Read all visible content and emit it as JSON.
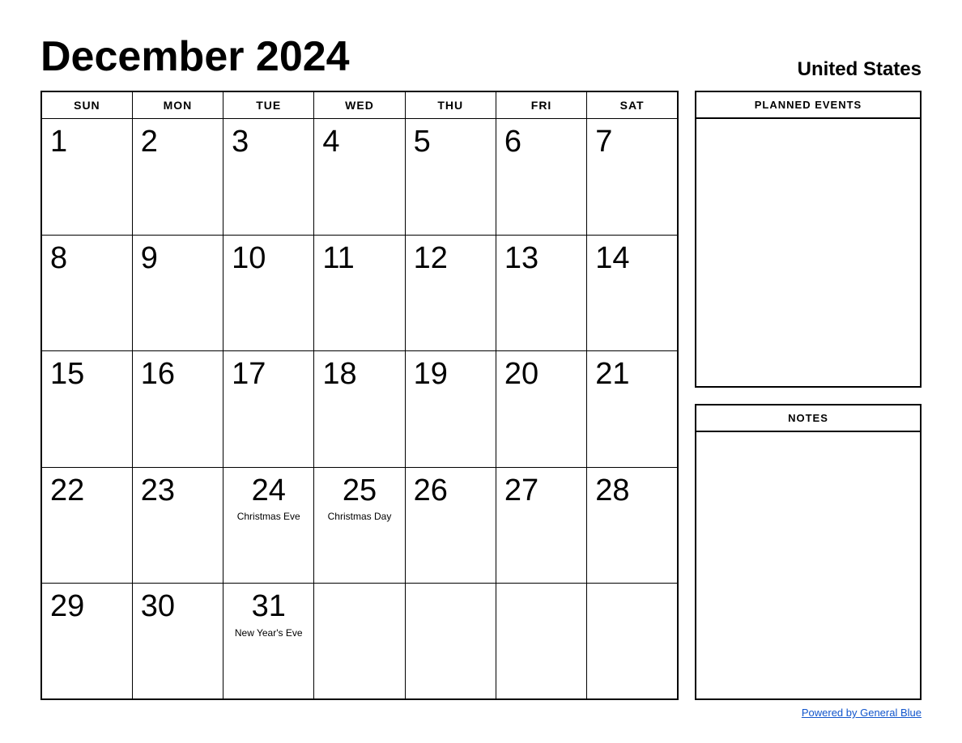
{
  "header": {
    "title": "December 2024",
    "country": "United States"
  },
  "calendar": {
    "days_of_week": [
      "SUN",
      "MON",
      "TUE",
      "WED",
      "THU",
      "FRI",
      "SAT"
    ],
    "weeks": [
      [
        {
          "day": "1",
          "holiday": ""
        },
        {
          "day": "2",
          "holiday": ""
        },
        {
          "day": "3",
          "holiday": ""
        },
        {
          "day": "4",
          "holiday": ""
        },
        {
          "day": "5",
          "holiday": ""
        },
        {
          "day": "6",
          "holiday": ""
        },
        {
          "day": "7",
          "holiday": ""
        }
      ],
      [
        {
          "day": "8",
          "holiday": ""
        },
        {
          "day": "9",
          "holiday": ""
        },
        {
          "day": "10",
          "holiday": ""
        },
        {
          "day": "11",
          "holiday": ""
        },
        {
          "day": "12",
          "holiday": ""
        },
        {
          "day": "13",
          "holiday": ""
        },
        {
          "day": "14",
          "holiday": ""
        }
      ],
      [
        {
          "day": "15",
          "holiday": ""
        },
        {
          "day": "16",
          "holiday": ""
        },
        {
          "day": "17",
          "holiday": ""
        },
        {
          "day": "18",
          "holiday": ""
        },
        {
          "day": "19",
          "holiday": ""
        },
        {
          "day": "20",
          "holiday": ""
        },
        {
          "day": "21",
          "holiday": ""
        }
      ],
      [
        {
          "day": "22",
          "holiday": ""
        },
        {
          "day": "23",
          "holiday": ""
        },
        {
          "day": "24",
          "holiday": "Christmas Eve"
        },
        {
          "day": "25",
          "holiday": "Christmas Day"
        },
        {
          "day": "26",
          "holiday": ""
        },
        {
          "day": "27",
          "holiday": ""
        },
        {
          "day": "28",
          "holiday": ""
        }
      ],
      [
        {
          "day": "29",
          "holiday": ""
        },
        {
          "day": "30",
          "holiday": ""
        },
        {
          "day": "31",
          "holiday": "New Year's Eve"
        },
        {
          "day": "",
          "holiday": ""
        },
        {
          "day": "",
          "holiday": ""
        },
        {
          "day": "",
          "holiday": ""
        },
        {
          "day": "",
          "holiday": ""
        }
      ]
    ]
  },
  "sidebar": {
    "planned_events_label": "PLANNED EVENTS",
    "notes_label": "NOTES"
  },
  "footer": {
    "powered_by": "Powered by General Blue",
    "link": "#"
  }
}
